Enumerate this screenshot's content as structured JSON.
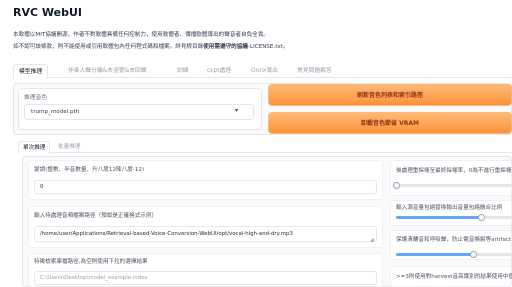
{
  "app": {
    "title": "RVC WebUI"
  },
  "description": {
    "line1": "本軟體以MIT協議開源，作者不對軟體具備任何控制力，使用軟體者、傳播軟體導出的聲音者自負全責。",
    "line2_prefix": "如不認可該條款，則不能使用或引用軟體包內任何程式碼和檔案。詳見根目錄",
    "line2_link": "使用需遵守的協議",
    "line2_suffix": "-LICENSE.txt。"
  },
  "tabs": [
    {
      "label": "模型推理",
      "active": true
    },
    {
      "label": "伴奏人聲分離&去混響&去回聲",
      "active": false
    },
    {
      "label": "訓練",
      "active": false
    },
    {
      "label": "ckpt處理",
      "active": false
    },
    {
      "label": "Onnx導出",
      "active": false
    },
    {
      "label": "常見問題解答",
      "active": false
    }
  ],
  "model": {
    "voice_label": "推理音色",
    "voice_value": "trump_model.pth",
    "refresh_button": "刷新音色列表和索引路徑",
    "unload_button": "卸載音色節省 VRAM"
  },
  "subtabs": [
    {
      "label": "單次推理",
      "active": true
    },
    {
      "label": "批量推理",
      "active": false
    }
  ],
  "single": {
    "pitch_label": "變調(整數、半音數量、升八度12降八度-12)",
    "pitch_value": "0",
    "path_label": "輸入待處理音頻檔案路徑（預設是正確格式示例）",
    "path_value": "/home/user/Applications/Retrieval-based-Voice-Conversion-WebUI/opt/vocal-high-and-dry.mp3",
    "index_label": "特徵檢索庫檔路徑,為空則使用下拉的選擇結果",
    "index_placeholder": "C:\\Users\\Desktop\\model_example.index",
    "resample_label": "後處理重採樣至最終採樣率，0為不進行重採樣",
    "rms_label": "輸入源音量包絡替換輸出音量包絡融合比例",
    "protect_label": "保護清輔音和呼吸聲，防止電音撕裂等artifact",
    "f0_label": ">=3則使用對harvest音高識別的結果使用中值濾波"
  },
  "sliders": {
    "resample_level": 0.0,
    "rms_level": 0.73,
    "protect_level": 0.66
  }
}
